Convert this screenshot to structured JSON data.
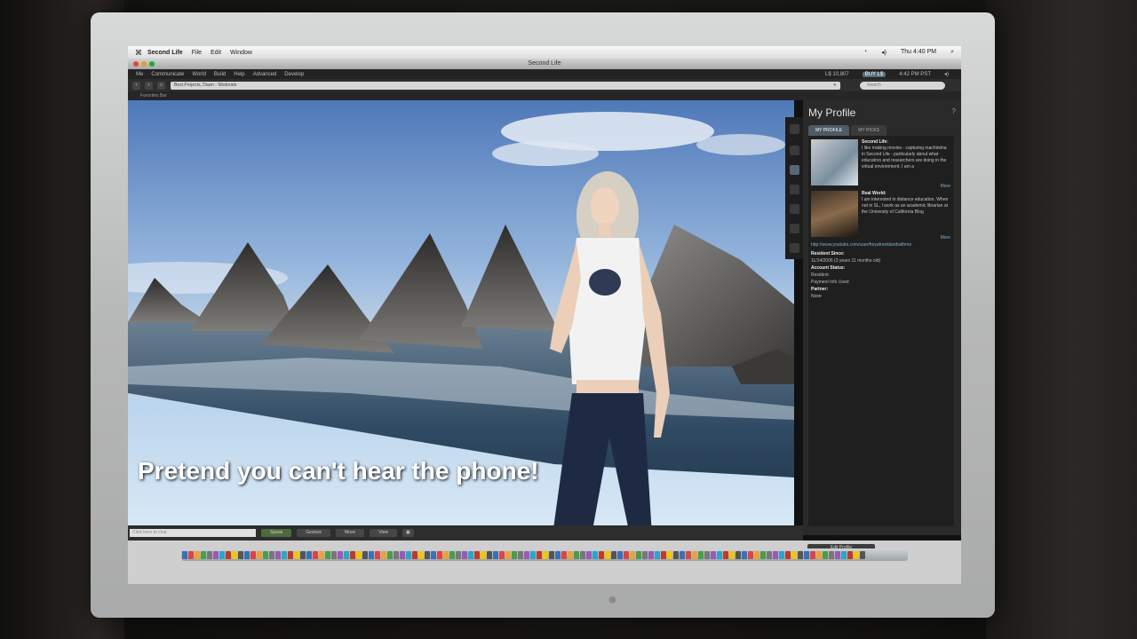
{
  "mac_menubar": {
    "app": "Second Life",
    "menus": [
      "File",
      "Edit",
      "Window"
    ],
    "clock": "Thu 4:40 PM"
  },
  "window": {
    "title": "Second Life"
  },
  "sl_menus": [
    "Me",
    "Communicate",
    "World",
    "Build",
    "Help",
    "Advanced",
    "Develop"
  ],
  "status": {
    "balance": "L$ 10,807",
    "buy_label": "BUY L$",
    "time": "4:42 PM PST"
  },
  "navbar": {
    "location": "Best Projects, Dawn - Moderate",
    "search_placeholder": "Search"
  },
  "favorites": {
    "label": "Favorites Bar"
  },
  "subtitle": "Pretend you can't hear the phone!",
  "bottombar": {
    "chat_placeholder": "Click here to chat",
    "speak": "Speak",
    "gesture": "Gesture",
    "move": "Move",
    "view": "View"
  },
  "profile": {
    "title": "My Profile",
    "help": "?",
    "tabs": [
      "MY PROFILE",
      "MY PICKS"
    ],
    "second_life_heading": "Second Life:",
    "second_life_text": "I like making movies - capturing machinima in Second Life - particularly about what educators and researchers are doing in the virtual environment. I am a",
    "real_world_heading": "Real World:",
    "real_world_text": "I am interested in distance education. When not in SL, I work as an academic librarian at the University of California Blog",
    "more": "More",
    "link": "http://www.youtube.com/user/freyafranklandwithme",
    "resident_since_label": "Resident Since:",
    "resident_since": "11/14/2006 (3 years 11 months old)",
    "account_label": "Account Status:",
    "account_lines": [
      "Resident",
      "Payment Info Used"
    ],
    "partner_label": "Partner:",
    "partner": "None",
    "edit_button": "Edit Profile"
  },
  "colors": {
    "sky_top": "#5f86c4",
    "sky_bottom": "#bcd2e9",
    "water": "#2f4a63",
    "panel": "#2a2a2a",
    "accent": "#4e5b66"
  }
}
